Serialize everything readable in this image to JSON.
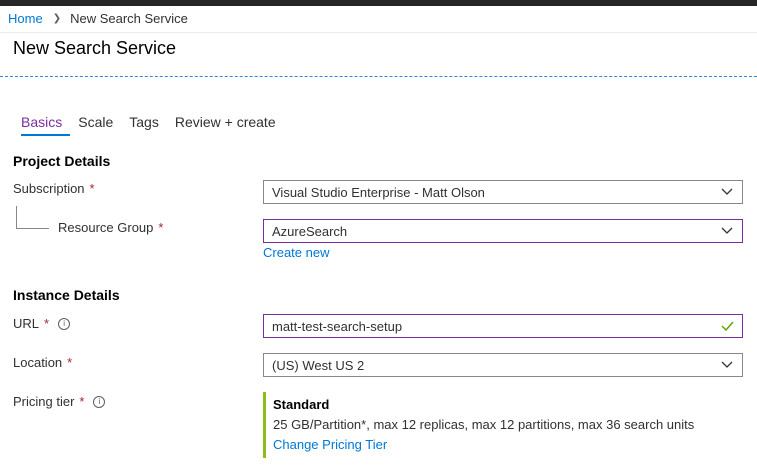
{
  "breadcrumb": {
    "home": "Home",
    "current": "New Search Service"
  },
  "page_title": "New Search Service",
  "tabs": [
    {
      "label": "Basics",
      "active": true
    },
    {
      "label": "Scale",
      "active": false
    },
    {
      "label": "Tags",
      "active": false
    },
    {
      "label": "Review + create",
      "active": false
    }
  ],
  "project_details": {
    "heading": "Project Details",
    "subscription": {
      "label": "Subscription",
      "value": "Visual Studio Enterprise - Matt Olson"
    },
    "resource_group": {
      "label": "Resource Group",
      "value": "AzureSearch",
      "create_new": "Create new"
    }
  },
  "instance_details": {
    "heading": "Instance Details",
    "url": {
      "label": "URL",
      "value": "matt-test-search-setup"
    },
    "location": {
      "label": "Location",
      "value": "(US) West US 2"
    },
    "pricing_tier": {
      "label": "Pricing tier",
      "name": "Standard",
      "description": "25 GB/Partition*, max 12 replicas, max 12 partitions, max 36 search units",
      "change_link": "Change Pricing Tier"
    }
  },
  "required_marker": "*",
  "info_glyph": "i",
  "colors": {
    "accent": "#0078d4",
    "active_tab": "#7b2f9e",
    "required": "#a4262c",
    "tier_bar": "#8cbd18",
    "valid_check": "#57a300"
  }
}
